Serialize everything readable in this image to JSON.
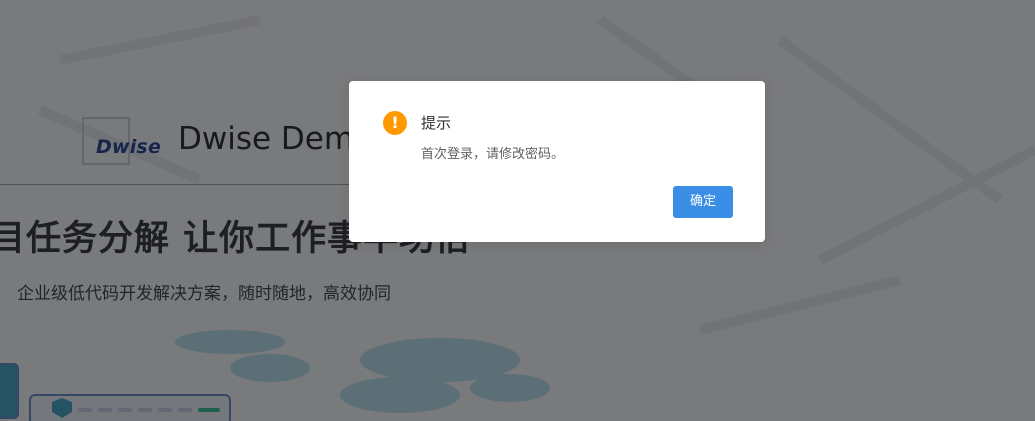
{
  "background": {
    "logo_text": "Dwise",
    "brand_title": "Dwise Demo",
    "hero_title": "目任务分解  让你工作事半功倍",
    "hero_subtitle": "企业级低代码开发解决方案，随时随地，高效协同"
  },
  "dialog": {
    "icon": "warning-icon",
    "icon_glyph": "!",
    "title": "提示",
    "message": "首次登录，请修改密码。",
    "confirm_label": "确定"
  },
  "colors": {
    "overlay": "rgba(0,0,0,0.5)",
    "warning": "#ff9900",
    "primary_button": "#3a8ee6"
  }
}
